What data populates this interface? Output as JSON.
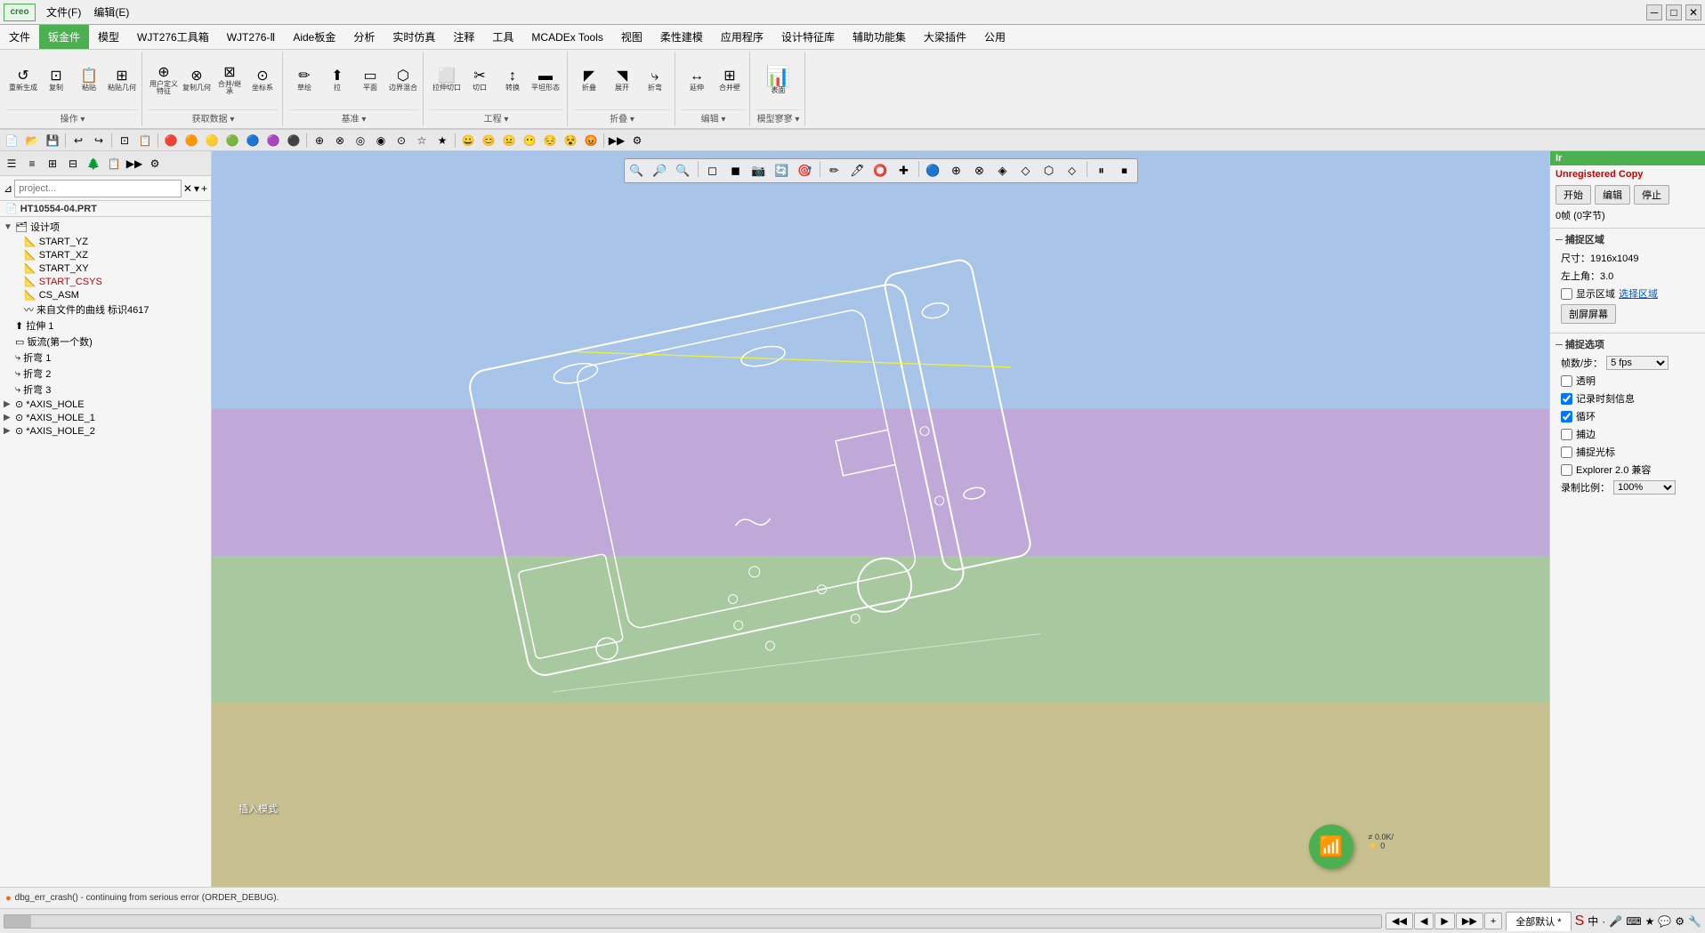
{
  "app": {
    "logo": "creo",
    "title": "Creo"
  },
  "titlebar": {
    "menus": [
      "文件(F)",
      "编辑(E)"
    ],
    "win_minimize": "─",
    "win_restore": "□",
    "win_close": "✕"
  },
  "menubar": {
    "tabs": [
      {
        "label": "文件",
        "active": false
      },
      {
        "label": "钣金件",
        "active": true,
        "highlight": true
      },
      {
        "label": "模型",
        "active": false
      },
      {
        "label": "WJT276工具箱",
        "active": false
      },
      {
        "label": "WJT276-Ⅱ",
        "active": false
      },
      {
        "label": "Aide板金",
        "active": false
      },
      {
        "label": "分析",
        "active": false
      },
      {
        "label": "实时仿真",
        "active": false
      },
      {
        "label": "注释",
        "active": false
      },
      {
        "label": "工具",
        "active": false
      },
      {
        "label": "MCADEx Tools",
        "active": false
      },
      {
        "label": "视图",
        "active": false
      },
      {
        "label": "柔性建模",
        "active": false
      },
      {
        "label": "应用程序",
        "active": false
      },
      {
        "label": "设计特征库",
        "active": false
      },
      {
        "label": "辅助功能集",
        "active": false
      },
      {
        "label": "大梁插件",
        "active": false
      },
      {
        "label": "公用",
        "active": false
      }
    ]
  },
  "ribbon": {
    "groups": [
      {
        "label": "操作 ▾",
        "buttons": [
          {
            "icon": "↺",
            "label": "重新生成"
          },
          {
            "icon": "⊡",
            "label": "复制"
          },
          {
            "icon": "✂",
            "label": "粘贴"
          },
          {
            "icon": "⊞",
            "label": "粘贴几何"
          }
        ]
      },
      {
        "label": "获取数据 ▾",
        "buttons": [
          {
            "icon": "⊕",
            "label": "用户定义特征"
          },
          {
            "icon": "⊗",
            "label": "复制几何"
          },
          {
            "icon": "⊠",
            "label": "合并/继承"
          },
          {
            "icon": "⊙",
            "label": "坐标系"
          }
        ]
      },
      {
        "label": "基准 ▾",
        "buttons": [
          {
            "icon": "▭",
            "label": "草绘"
          },
          {
            "icon": "✦",
            "label": "拉"
          },
          {
            "icon": "≡",
            "label": "平面"
          },
          {
            "icon": "⊹",
            "label": "边界混合"
          }
        ]
      },
      {
        "label": "工程 ▾",
        "buttons": [
          {
            "icon": "⌂",
            "label": "拉伸切口"
          },
          {
            "icon": "◈",
            "label": "切口"
          },
          {
            "icon": "◇",
            "label": "转换"
          },
          {
            "icon": "⬡",
            "label": "平坦形态"
          }
        ]
      },
      {
        "label": "折叠 ▾",
        "buttons": [
          {
            "icon": "◤",
            "label": "折叠"
          },
          {
            "icon": "◥",
            "label": "展开"
          },
          {
            "icon": "⬦",
            "label": "折弯"
          }
        ]
      },
      {
        "label": "编辑 ▾",
        "buttons": [
          {
            "icon": "≣",
            "label": "延伸"
          },
          {
            "icon": "⊞",
            "label": "合并"
          },
          {
            "icon": "⊟",
            "label": "合并壁"
          }
        ]
      },
      {
        "label": "模型寥寥 ▾",
        "buttons": [
          {
            "icon": "⊞",
            "label": "表面"
          }
        ]
      }
    ]
  },
  "toolbar2": {
    "buttons": [
      "↩",
      "↪",
      "⬚",
      "💾",
      "✂",
      "⊕",
      "⊗",
      "↺",
      "↻",
      "⊡",
      "⊠",
      "⊹",
      "⊙",
      "◎",
      "◉",
      "⊕",
      "⊗",
      "◈",
      "◇",
      "⬡",
      "◤",
      "◥",
      "⬦",
      "≣",
      "⊞",
      "⊟",
      "▭",
      "✦",
      "≡",
      "⊹"
    ]
  },
  "left_panel": {
    "filter_placeholder": "project...",
    "file_name": "HT10554-04.PRT",
    "tree_items": [
      {
        "level": 0,
        "icon": "📁",
        "label": "设计项",
        "expandable": true
      },
      {
        "level": 1,
        "icon": "📐",
        "label": "START_YZ"
      },
      {
        "level": 1,
        "icon": "📐",
        "label": "START_XZ"
      },
      {
        "level": 1,
        "icon": "📐",
        "label": "START_XY"
      },
      {
        "level": 1,
        "icon": "📐",
        "label": "START_CSYS",
        "red": true
      },
      {
        "level": 1,
        "icon": "📐",
        "label": "CS_ASM"
      },
      {
        "level": 1,
        "icon": "🔧",
        "label": "来自文件的曲线 标识4617"
      },
      {
        "level": 0,
        "icon": "🔩",
        "label": "拉伸 1"
      },
      {
        "level": 0,
        "icon": "🔩",
        "label": "钣流(第一个数)"
      },
      {
        "level": 0,
        "icon": "🔩",
        "label": "折弯 1"
      },
      {
        "level": 0,
        "icon": "🔩",
        "label": "折弯 2"
      },
      {
        "level": 0,
        "icon": "🔩",
        "label": "折弯 3"
      },
      {
        "level": 0,
        "icon": "🔩",
        "label": "*AXIS_HOLE",
        "expandable": true
      },
      {
        "level": 0,
        "icon": "🔩",
        "label": "*AXIS_HOLE_1",
        "expandable": true
      },
      {
        "level": 0,
        "icon": "🔩",
        "label": "*AXIS_HOLE_2",
        "expandable": true
      }
    ]
  },
  "viewport": {
    "model_label": "插入模式",
    "nav_buttons": [
      "🔍",
      "🔎",
      "🔍",
      "◻",
      "◼",
      "📷",
      "🔄",
      "🎯",
      "✏",
      "🖊",
      "🔵",
      "⊕",
      "⊗",
      "◈",
      "◇",
      "⬡",
      "⬦",
      "≣",
      "▮",
      "▯",
      "⬡"
    ]
  },
  "right_panel": {
    "title": "Ir",
    "unregistered": "Unregistered Copy",
    "rec_btn": "开始",
    "edit_btn": "编辑",
    "stop_btn": "停止",
    "frame_count": "0帧 (0字节)",
    "capture_section": "捕捉区域",
    "size_label": "尺寸：1916x1049",
    "margin_label": "左上角：3.0",
    "show_area_label": "显示区域",
    "select_area_label": "选择区域",
    "split_screen_btn": "剖屏屏幕",
    "capture_options": "捕捉选项",
    "fps_label": "帧数/步：",
    "fps_value": "5 fps",
    "transparent_label": "透明",
    "record_timestamp_label": "记录时刻信息",
    "loop_label": "循环",
    "snap_edge_label": "捕边",
    "snap_cursor_label": "捕捉光标",
    "explorer_compat_label": "Explorer 2.0 兼容",
    "record_scale_label": "录制比例：",
    "record_scale_value": "100%"
  },
  "statusbar": {
    "error_text": "dbg_err_crash() - continuing from serious error (ORDER_DEBUG)."
  },
  "bottombar": {
    "nav_prev_prev": "◀◀",
    "nav_prev": "◀",
    "nav_next": "▶",
    "nav_next_next": "▶▶",
    "add_btn": "+",
    "tab_label": "全部默认 *",
    "input_cmd_placeholder": ""
  },
  "network": {
    "icon": "📶",
    "speed": "≠ 0.0K/",
    "count": "⚡ 0"
  },
  "colors": {
    "accent_green": "#4caf50",
    "menu_bg": "#f5f5f5",
    "viewport_sky": "#a8c4e8",
    "viewport_purple": "#c0a8d8",
    "viewport_green": "#a8c8a0",
    "viewport_tan": "#c8c090"
  }
}
